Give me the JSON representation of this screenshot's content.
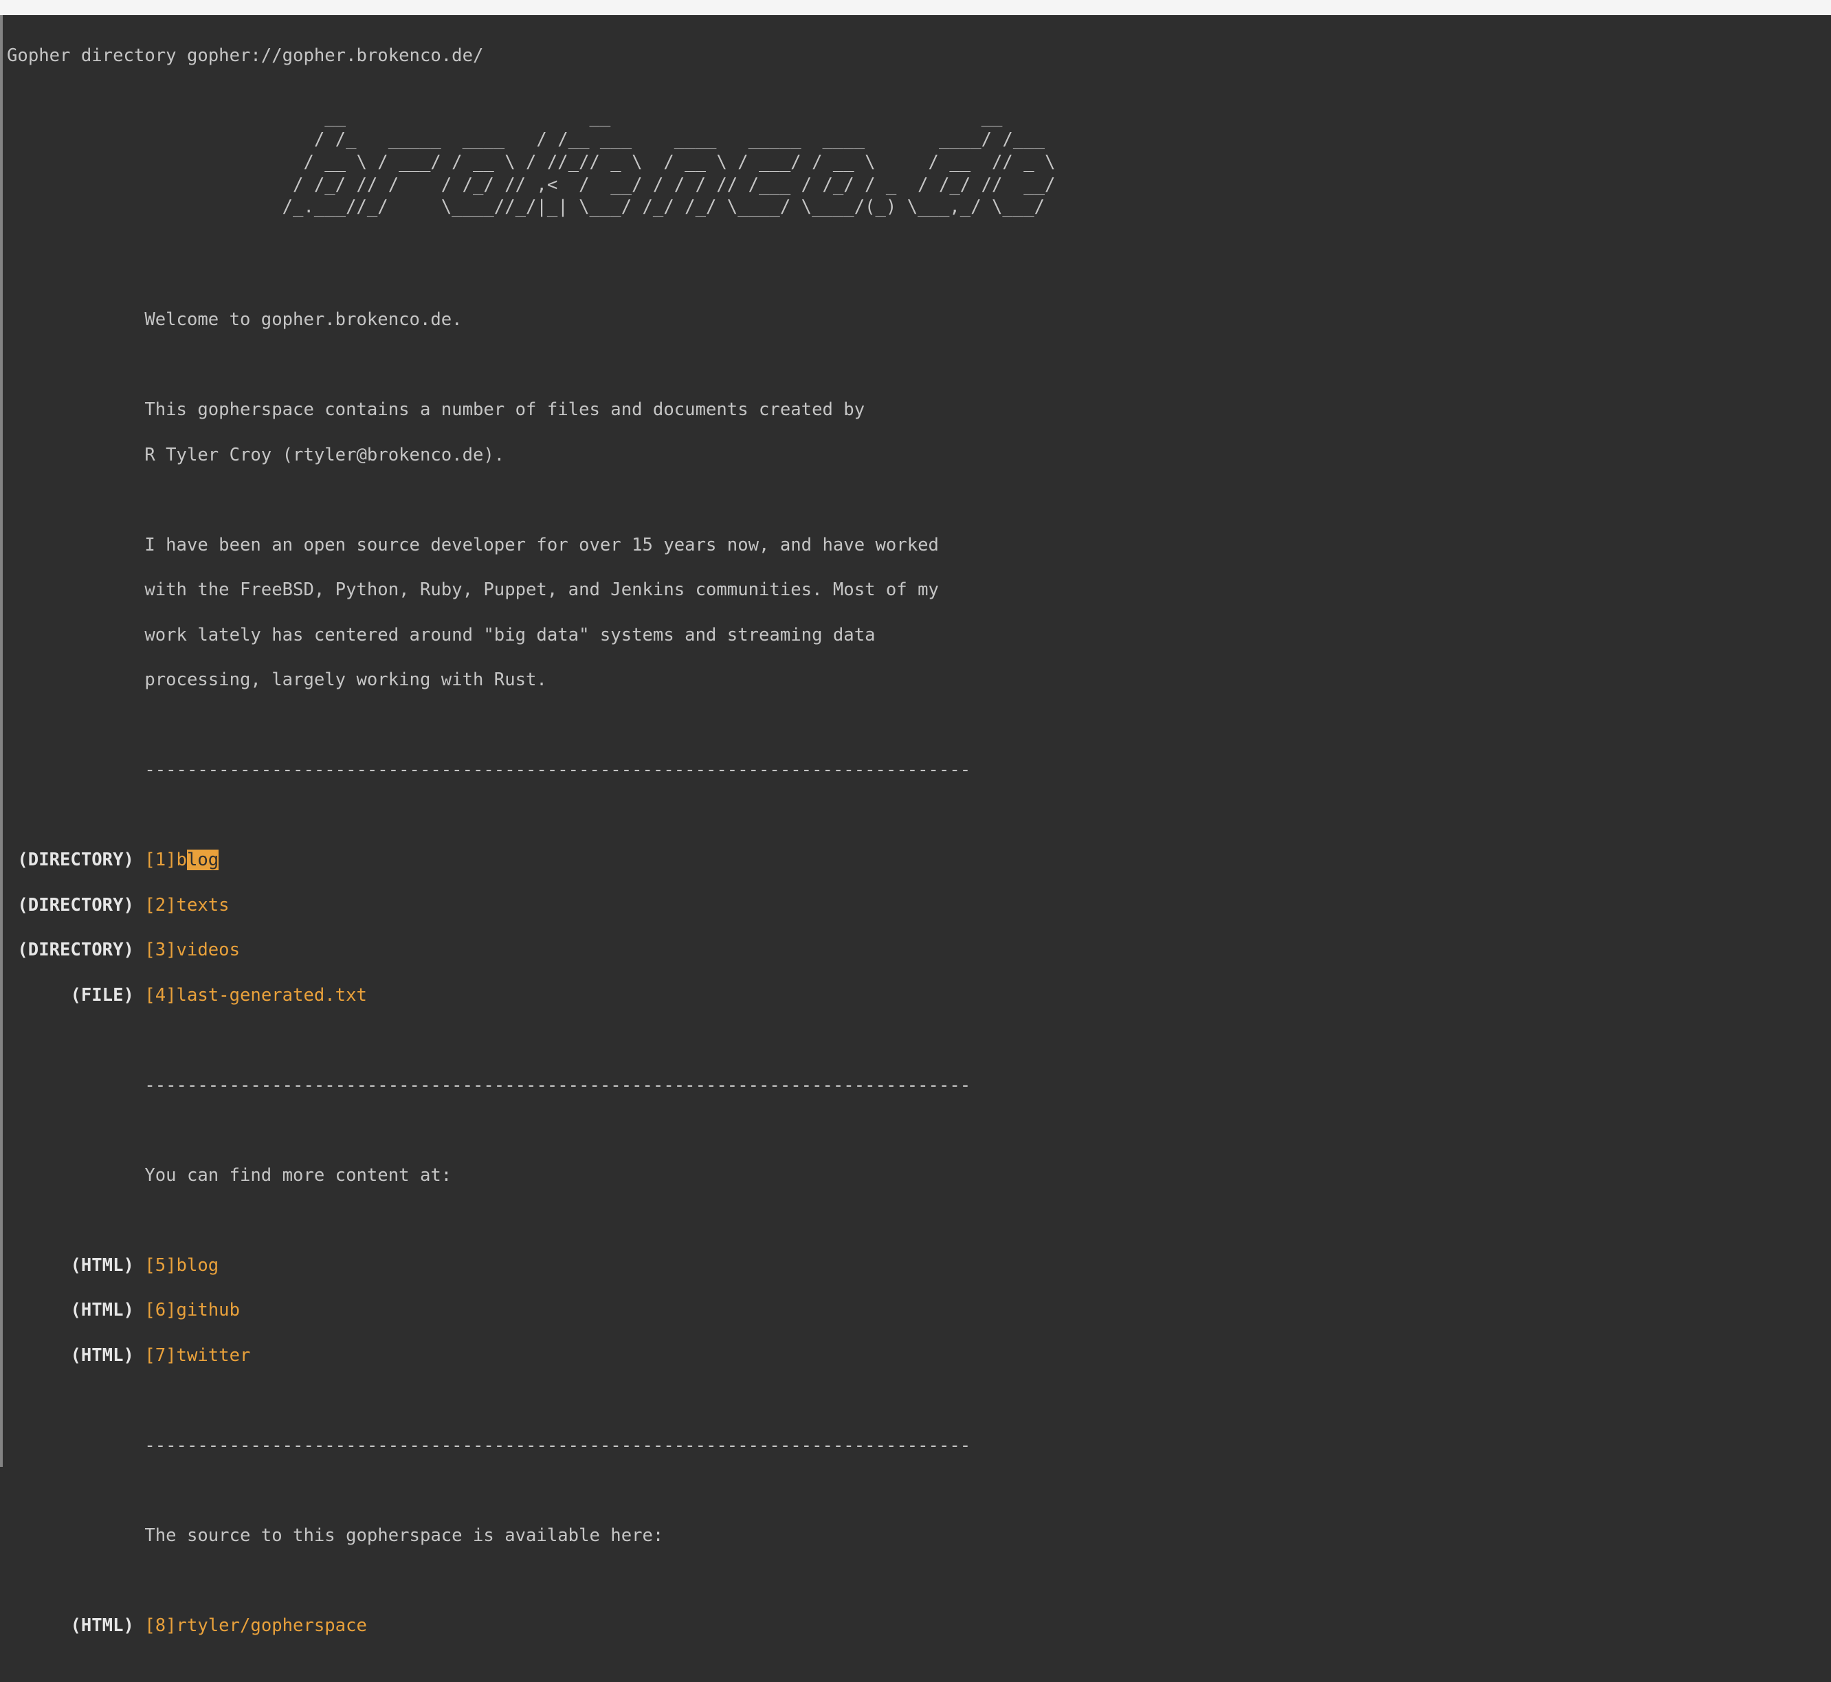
{
  "header": {
    "title": "Gopher directory gopher://gopher.brokenco.de/"
  },
  "ascii_art": "                              __                       __                                   __\n                             / /_   _____  ____   / /__ ___    ____   _____  ____       ____/ /___\n                            / __ \\ / ___/ / __ \\ / //_// _ \\  / __ \\ / ___/ / __ \\     / __  // _ \\\n                           / /_/ // /    / /_/ // ,<  /  __/ / / / // /___ / /_/ / _  / /_/ //  __/\n                          /_.___//_/     \\____//_/|_| \\___/ /_/ /_/ \\____/ \\____/(_) \\___,_/ \\___/",
  "intro": {
    "welcome": "Welcome to gopher.brokenco.de.",
    "line1": "This gopherspace contains a number of files and documents created by",
    "line2": "R Tyler Croy (rtyler@brokenco.de).",
    "bio1": "I have been an open source developer for over 15 years now, and have worked",
    "bio2": "with the FreeBSD, Python, Ruby, Puppet, and Jenkins communities. Most of my",
    "bio3": "work lately has centered around \"big data\" systems and streaming data",
    "bio4": "processing, largely working with Rust."
  },
  "divider": "------------------------------------------------------------------------------",
  "entries1": [
    {
      "type": "(DIRECTORY)",
      "idx": "[1]",
      "prefix": "b",
      "selected": "log",
      "suffix": ""
    },
    {
      "type": "(DIRECTORY)",
      "idx": "[2]",
      "label": "texts"
    },
    {
      "type": "(DIRECTORY)",
      "idx": "[3]",
      "label": "videos"
    },
    {
      "type": "(FILE)",
      "idx": "[4]",
      "label": "last-generated.txt"
    }
  ],
  "more_content": "You can find more content at:",
  "entries2": [
    {
      "type": "(HTML)",
      "idx": "[5]",
      "label": "blog"
    },
    {
      "type": "(HTML)",
      "idx": "[6]",
      "label": "github"
    },
    {
      "type": "(HTML)",
      "idx": "[7]",
      "label": "twitter"
    }
  ],
  "source_line": "The source to this gopherspace is available here:",
  "entries3": [
    {
      "type": "(HTML)",
      "idx": "[8]",
      "label": "rtyler/gopherspace"
    }
  ]
}
